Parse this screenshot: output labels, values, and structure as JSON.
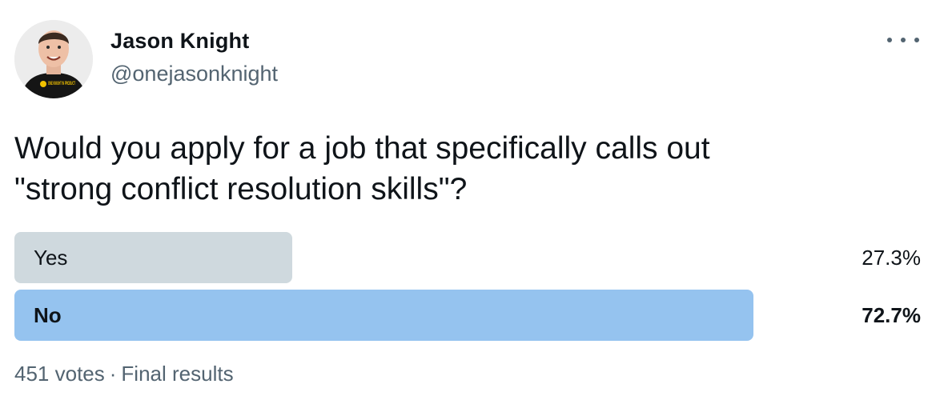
{
  "author": {
    "name": "Jason Knight",
    "handle": "@onejasonknight",
    "avatar_shirt_text": "ONE KNIGHT IN PRODUCT"
  },
  "tweet": {
    "text_line1": "Would you apply for a job that specifically calls out",
    "text_line2": "\"strong conflict resolution skills\"?"
  },
  "poll": {
    "options": [
      {
        "label": "Yes",
        "percent_text": "27.3%",
        "percent": 27.3,
        "winner": false
      },
      {
        "label": "No",
        "percent_text": "72.7%",
        "percent": 72.7,
        "winner": true
      }
    ],
    "votes": "451 votes",
    "separator": "·",
    "status": "Final results"
  },
  "colors": {
    "bar_default": "#cfd9de",
    "bar_winner": "#95c3ef",
    "text_primary": "#0f1419",
    "text_secondary": "#536471"
  },
  "icons": {
    "more": "more-horizontal-icon"
  }
}
